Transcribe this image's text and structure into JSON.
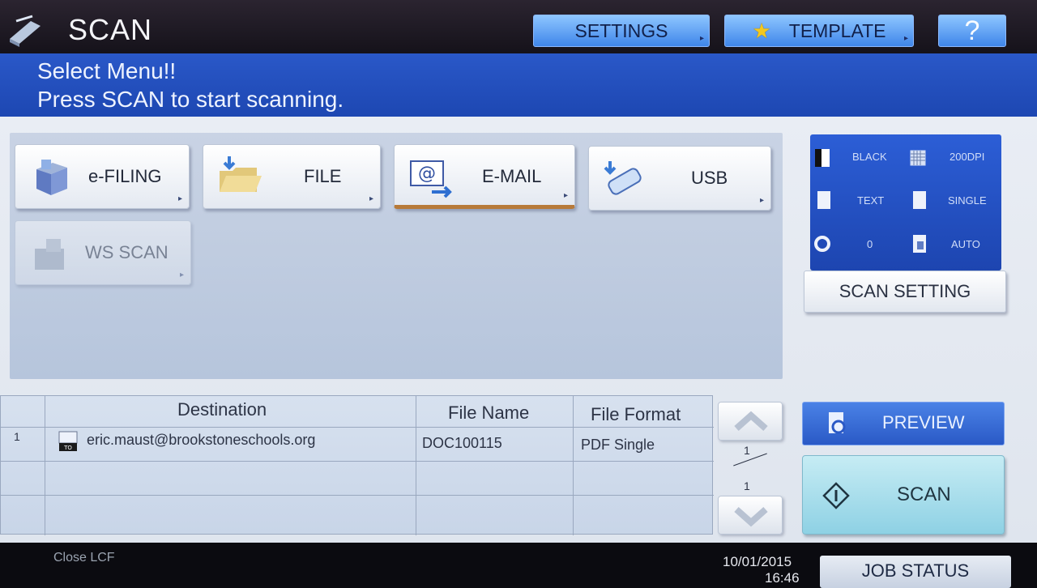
{
  "header": {
    "title": "SCAN",
    "settings_label": "SETTINGS",
    "template_label": "TEMPLATE",
    "help_label": "?"
  },
  "message": {
    "line1": "Select Menu!!",
    "line2": "Press SCAN to start scanning."
  },
  "menu": {
    "efiling": "e-FILING",
    "file": "FILE",
    "email": "E-MAIL",
    "usb": "USB",
    "wsscan": "WS SCAN"
  },
  "status": {
    "color_mode": "BLACK",
    "resolution": "200DPI",
    "original_mode": "TEXT",
    "sides": "SINGLE",
    "rotation": "0",
    "size": "AUTO"
  },
  "scan_setting_label": "SCAN SETTING",
  "table": {
    "headers": {
      "destination": "Destination",
      "file_name": "File Name",
      "file_format": "File Format"
    },
    "rows": [
      {
        "num": "1",
        "destination": "eric.maust@brookstoneschools.org",
        "file_name": "DOC100115",
        "file_format": "PDF Single"
      }
    ]
  },
  "pager": {
    "current": "1",
    "total": "1"
  },
  "preview_label": "PREVIEW",
  "scan_label": "SCAN",
  "footer": {
    "close_lcf": "Close LCF",
    "date": "10/01/2015",
    "time": "16:46",
    "job_status": "JOB STATUS"
  },
  "colors": {
    "message_bar": "#1d47b2",
    "top_button": "#5c9cf0",
    "scan_button": "#a9dfed",
    "status_box": "#2550c4"
  }
}
